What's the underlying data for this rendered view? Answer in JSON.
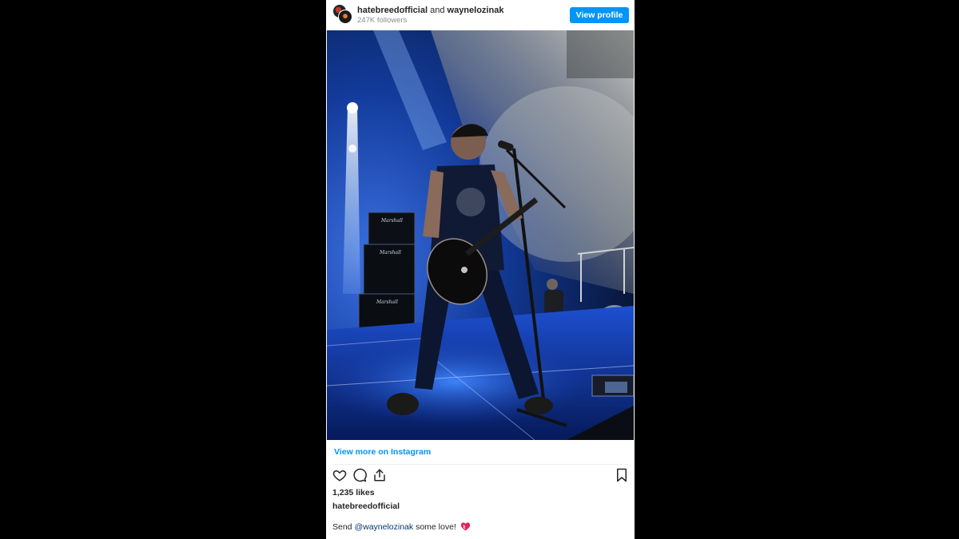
{
  "header": {
    "account_primary": "hatebreedofficial",
    "connector": "and",
    "account_secondary": "waynelozinak",
    "followers": "247K followers",
    "view_profile_label": "View profile"
  },
  "post": {
    "view_more_label": "View more on Instagram",
    "likes": "1,235 likes",
    "owner": "hatebreedofficial",
    "caption_prefix": "Send ",
    "caption_mention": "@waynelozinak",
    "caption_suffix": " some love! "
  },
  "photo_texts": {
    "amp_brand_1": "Marshall",
    "amp_brand_2": "Marshall",
    "amp_brand_3": "Marshall"
  },
  "icons": [
    "heart-icon",
    "comment-icon",
    "share-icon",
    "bookmark-icon",
    "mending-heart-emoji"
  ],
  "colors": {
    "link_blue": "#0095f6",
    "button_blue": "#0095f6",
    "text": "#262626",
    "muted": "#8e8e8e",
    "mention": "#00376b",
    "background": "#000000"
  }
}
